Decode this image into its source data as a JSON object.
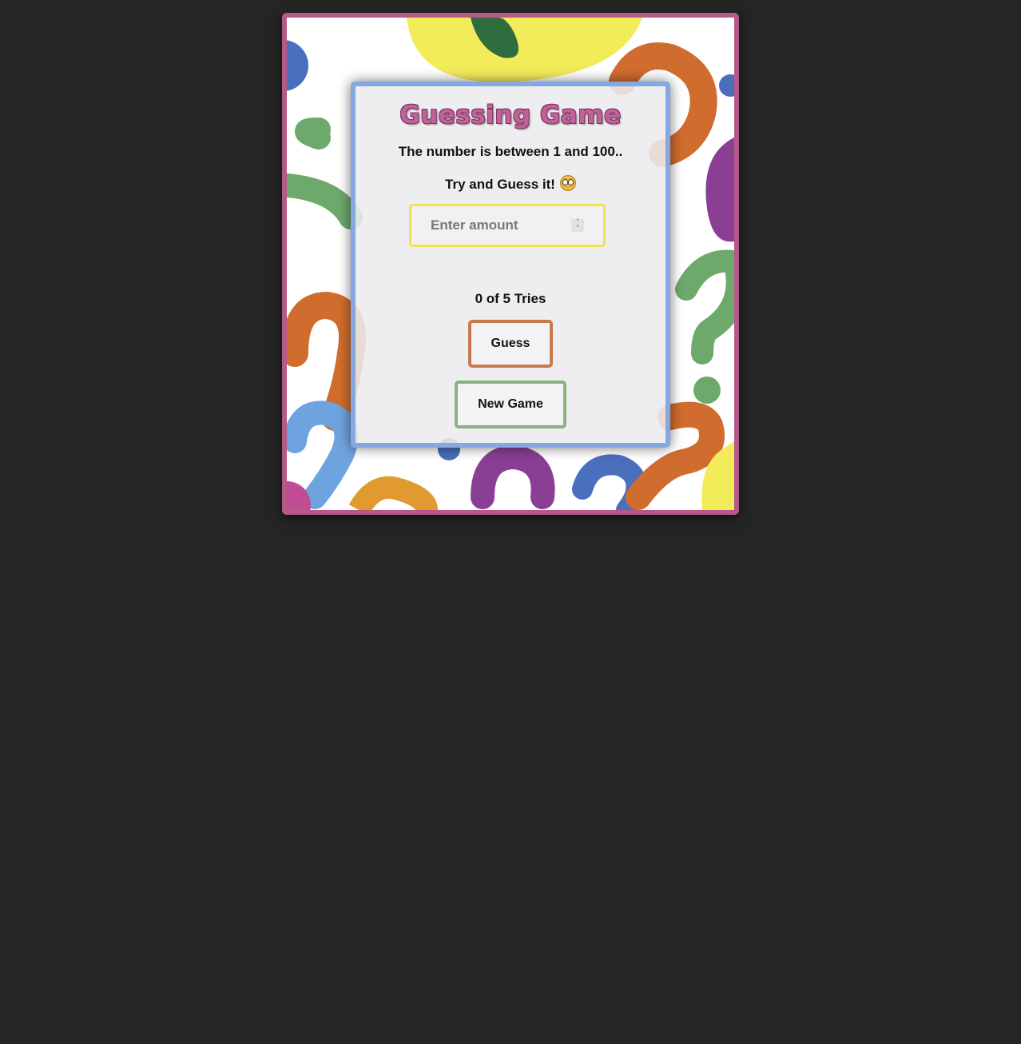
{
  "game": {
    "title": "Guessing Game",
    "instruction_range": "The number is between 1 and 100..",
    "instruction_prompt": "Try and Guess it!",
    "input_placeholder": "Enter amount",
    "input_value": "",
    "tries_text": "0 of 5 Tries",
    "guess_button_label": "Guess",
    "new_game_button_label": "New Game"
  },
  "colors": {
    "page_background": "#252525",
    "frame_border": "#b55a88",
    "card_border": "#86a8e0",
    "title": "#c2609a",
    "input_border": "#f0e254",
    "guess_border": "#c77a4c",
    "new_game_border": "#8ab183"
  },
  "icons": {
    "prompt_emoji": "thinking-face-icon",
    "input_spinner": "number-spinner-icon",
    "background": "question-marks-pattern"
  }
}
